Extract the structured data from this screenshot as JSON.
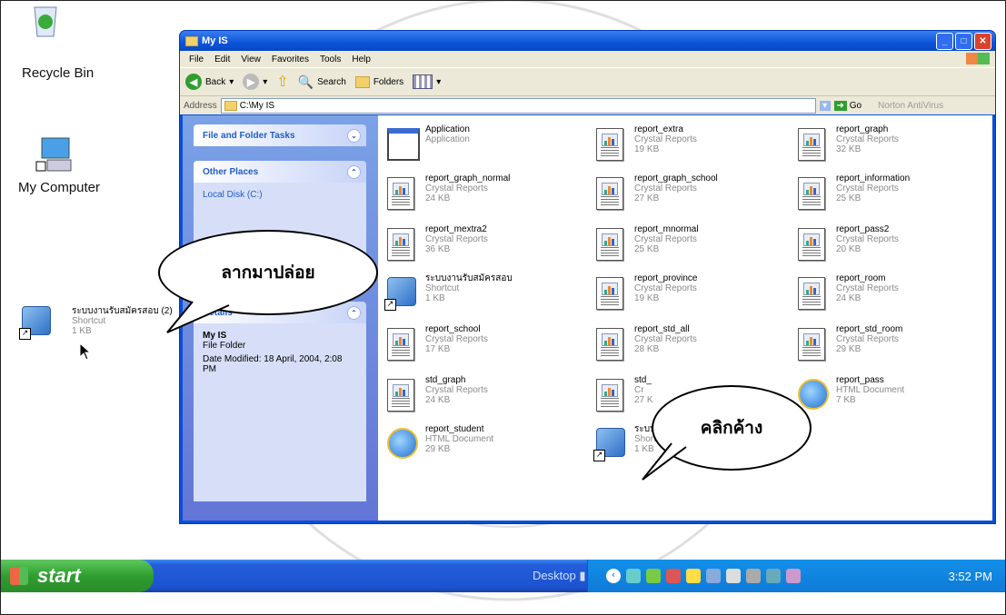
{
  "desktop": {
    "icons": [
      {
        "label": "Recycle Bin"
      },
      {
        "label": "My Computer"
      },
      {
        "label": "ระบบงานรับสมัครสอบ (2)",
        "sub1": "Shortcut",
        "sub2": "1 KB"
      }
    ]
  },
  "window": {
    "title": "My IS",
    "menu": [
      "File",
      "Edit",
      "View",
      "Favorites",
      "Tools",
      "Help"
    ],
    "toolbar": {
      "back": "Back",
      "search": "Search",
      "folders": "Folders"
    },
    "address": {
      "label": "Address",
      "value": "C:\\My IS",
      "go": "Go",
      "norton": "Norton AntiVirus"
    },
    "left_pane": {
      "file_tasks": "File and Folder Tasks",
      "other_places": "Other Places",
      "other_places_item": "Local Disk (C:)",
      "details": "Details",
      "details_name": "My IS",
      "details_type": "File Folder",
      "details_modified": "Date Modified: 18 April, 2004, 2:08 PM"
    },
    "files": [
      {
        "name": "Application",
        "type": "Application",
        "size": ""
      },
      {
        "name": "report_extra",
        "type": "Crystal Reports",
        "size": "19 KB"
      },
      {
        "name": "report_graph",
        "type": "Crystal Reports",
        "size": "32 KB"
      },
      {
        "name": "report_graph_normal",
        "type": "Crystal Reports",
        "size": "24 KB"
      },
      {
        "name": "report_graph_school",
        "type": "Crystal Reports",
        "size": "27 KB"
      },
      {
        "name": "report_information",
        "type": "Crystal Reports",
        "size": "25 KB"
      },
      {
        "name": "report_mextra2",
        "type": "Crystal Reports",
        "size": "36 KB"
      },
      {
        "name": "report_mnormal",
        "type": "Crystal Reports",
        "size": "25 KB"
      },
      {
        "name": "report_pass2",
        "type": "Crystal Reports",
        "size": "20 KB"
      },
      {
        "name": "ระบบงานรับสมัครสอบ",
        "type": "Shortcut",
        "size": "1 KB"
      },
      {
        "name": "report_province",
        "type": "Crystal Reports",
        "size": "19 KB"
      },
      {
        "name": "report_room",
        "type": "Crystal Reports",
        "size": "24 KB"
      },
      {
        "name": "report_school",
        "type": "Crystal Reports",
        "size": "17 KB"
      },
      {
        "name": "report_std_all",
        "type": "Crystal Reports",
        "size": "28 KB"
      },
      {
        "name": "report_std_room",
        "type": "Crystal Reports",
        "size": "29 KB"
      },
      {
        "name": "std_graph",
        "type": "Crystal Reports",
        "size": "24 KB"
      },
      {
        "name": "std_",
        "type": "Cr",
        "size": "27 K"
      },
      {
        "name": "report_pass",
        "type": "HTML Document",
        "size": "7 KB"
      },
      {
        "name": "report_student",
        "type": "HTML Document",
        "size": "29 KB"
      },
      {
        "name": "ระบบงาน",
        "type": "Shortcut",
        "size": "1 KB"
      }
    ]
  },
  "callouts": {
    "drag_drop": "ลากมาปล่อย",
    "click_hold": "คลิกค้าง"
  },
  "taskbar": {
    "start": "start",
    "desktop": "Desktop",
    "clock": "3:52 PM"
  },
  "colors": {
    "xp_blue": "#0a55d8",
    "start_green": "#2f9e2f",
    "tray_blue": "#0f7ad8"
  }
}
